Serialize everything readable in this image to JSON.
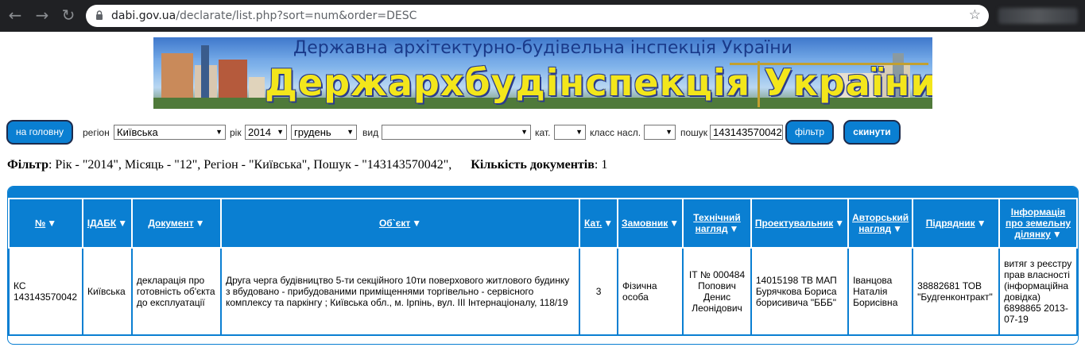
{
  "browser": {
    "back_icon": "back-arrow-icon",
    "forward_icon": "forward-arrow-icon",
    "reload_icon": "reload-icon",
    "url_host": "dabi.gov.ua",
    "url_path": "/declarate/list.php?sort=num&order=DESC",
    "star_icon": "star-icon"
  },
  "banner": {
    "subtitle": "Державна архітектурно-будівельна інспекція України",
    "title": "Держархбудінспекція України"
  },
  "toolbar": {
    "home_button": "на головну",
    "region_label": "регіон",
    "region_value": "Київська",
    "year_label": "рік",
    "year_value": "2014",
    "month_value": "грудень",
    "type_label": "вид",
    "type_value": "",
    "cat_label": "кат.",
    "cat_value": "",
    "class_label": "класс насл.",
    "class_value": "",
    "search_label": "пошук",
    "search_value": "143143570042",
    "filter_button": "фільтр",
    "reset_button": "скинути"
  },
  "filter_summary": {
    "filter_label": "Фільтр",
    "filter_text": ": Рік - \"2014\", Місяць - \"12\", Регіон - \"Київська\", Пошук - \"143143570042\",",
    "count_label": "Кількість документів",
    "count_value": ": 1"
  },
  "table": {
    "columns": [
      "№",
      "ІДАБК",
      "Документ",
      "Об`єкт",
      "Кат.",
      "Замовник",
      "Технічний нагляд",
      "Проектувальник",
      "Авторський нагляд",
      "Підрядник",
      "Інформація про земельну ділянку"
    ],
    "sort_icon": "▼",
    "rows": [
      {
        "num": "КС 143143570042",
        "idabk": "Київська",
        "document": "декларація про готовність об'єкта до експлуатації",
        "object": "Друга черга будівництво 5-ти секційного 10ти поверхового житлового будинку з вбудовано - прибудованими приміщеннями торгівельно - сервісного комплексу та паркінгу ; Київська обл., м. Ірпінь, вул. ІІІ Інтернаціоналу, 118/19",
        "cat": "3",
        "customer": "Фізична особа",
        "tech_supervision": "ІТ № 000484 Попович Денис Леонідович",
        "designer": "14015198 ТВ МАП Бурячкова Бориса борисивича \"БББ\"",
        "author_supervision": "Іванцова Наталія Борисівна",
        "contractor": "38882681 ТОВ \"Будгенконтракт\"",
        "land_info": "витяг з реєстру прав власності (інформаційна довідка) 6898865 2013-07-19"
      }
    ]
  }
}
